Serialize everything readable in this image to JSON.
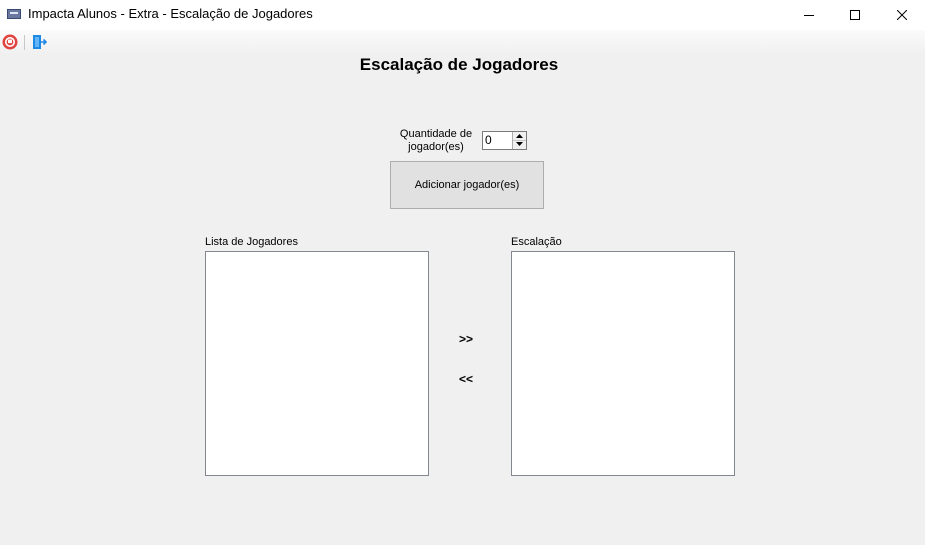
{
  "window": {
    "title": "Impacta Alunos - Extra - Escalação de Jogadores",
    "icon": "app-icon"
  },
  "toolbar": {
    "items": [
      {
        "icon": "exit-icon",
        "color": "#e0443e"
      },
      {
        "icon": "door-icon",
        "color": "#1e88e5"
      }
    ]
  },
  "form": {
    "heading": "Escalação de Jogadores",
    "quantity_label": "Quantidade de jogador(es)",
    "quantity_value": "0",
    "add_button": "Adicionar jogador(es)",
    "player_list_label": "Lista de Jogadores",
    "lineup_label": "Escalação",
    "move_right": ">>",
    "move_left": "<<"
  }
}
